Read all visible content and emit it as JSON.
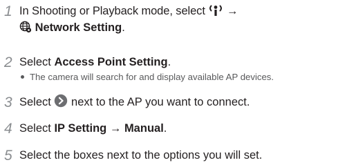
{
  "steps": [
    {
      "number": "1",
      "line1_text": "In Shooting or Playback mode, select",
      "wifi_icon": "wifi-icon",
      "arrow": "→",
      "globe_icon": "network-globe-icon",
      "line2_bold": "Network Setting",
      "line2_end": "."
    },
    {
      "number": "2",
      "prefix": "Select",
      "bold": "Access Point Setting",
      "suffix": ".",
      "bullet": "The camera will search for and display available AP devices."
    },
    {
      "number": "3",
      "prefix": "Select",
      "icon": "arrow-circle-icon",
      "suffix": "next to the AP you want to connect."
    },
    {
      "number": "4",
      "prefix": "Select",
      "bold1": "IP Setting",
      "arrow": "→",
      "bold2": "Manual",
      "suffix": "."
    },
    {
      "number": "5",
      "text": "Select the boxes next to the options you will set."
    }
  ]
}
